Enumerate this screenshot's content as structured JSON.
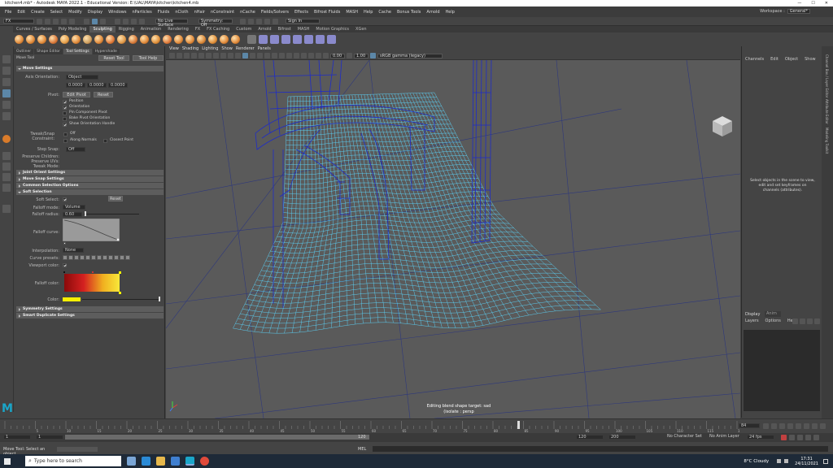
{
  "window": {
    "title": "kitchen4.mb* - Autodesk MAYA 2022.1 - Educational Version: E:\\UAL\\MAYA\\kitchen\\kitchen4.mb",
    "controls": [
      "—",
      "☐",
      "✕"
    ]
  },
  "menu": {
    "items": [
      "File",
      "Edit",
      "Create",
      "Select",
      "Modify",
      "Display",
      "Windows",
      "nParticles",
      "Fluids",
      "nCloth",
      "nHair",
      "nConstraint",
      "nCache",
      "Fields/Solvers",
      "Effects",
      "Bifrost Fluids",
      "MASH",
      "Help",
      "Cache",
      "Bonus Tools",
      "Arnold",
      "Help"
    ],
    "workspace_label": "Workspace :",
    "workspace_value": "General*"
  },
  "statusline": {
    "mode": "FX",
    "live_surface": "No Live Surface",
    "symmetry": "Symmetry: Off",
    "signin": "Sign In"
  },
  "shelf": {
    "tabs": [
      "Curves / Surfaces",
      "Poly Modeling",
      "Sculpting",
      "Rigging",
      "Animation",
      "Rendering",
      "FX",
      "FX Caching",
      "Custom",
      "Arnold",
      "Bifrost",
      "MASH",
      "Motion Graphics",
      "XGen"
    ],
    "active_tab": 2
  },
  "toolsettings": {
    "tabs": [
      "Outliner",
      "Shape Editor",
      "Tool Settings",
      "Hypershade"
    ],
    "tool_name": "Move Tool",
    "reset": "Reset Tool",
    "help": "Tool Help",
    "move_settings": "Move Settings",
    "axis_orientation_label": "Axis Orientation:",
    "axis_orientation": "Object",
    "xyz": [
      "0.0000",
      "0.0000",
      "0.0000"
    ],
    "pivot_label": "Pivot:",
    "edit_pivot": "Edit Pivot",
    "reset_btn": "Reset",
    "checks": [
      "Position",
      "Orientation",
      "Pin Component Pivot",
      "Bake Pivot Orientation",
      "Show Orientation Handle"
    ],
    "checks_on": [
      true,
      true,
      false,
      false,
      true
    ],
    "tweak_label": "Tweak/Snap Constraint:",
    "tweak_value": "Off",
    "along_normals": "Along Normals",
    "closest_point": "Closest Point",
    "step_snap_label": "Step Snap:",
    "step_snap": "Off",
    "preserve": [
      "Preserve Children:",
      "Preserve UVs:",
      "Tweak Mode:"
    ],
    "sections": [
      "Joint Orient Settings",
      "Move Snap Settings",
      "Common Selection Options",
      "Soft Selection",
      "Symmetry Settings",
      "Smart Duplicate Settings"
    ],
    "soft": {
      "soft_select_label": "Soft Select:",
      "reset": "Reset",
      "falloff_mode_label": "Falloff mode:",
      "falloff_mode": "Volume",
      "falloff_radius_label": "Falloff radius:",
      "falloff_radius": "0.60",
      "falloff_curve_label": "Falloff curve:",
      "interpolation_label": "Interpolation:",
      "interpolation": "None",
      "curve_presets_label": "Curve presets:",
      "viewport_color_label": "Viewport color:",
      "falloff_color_label": "Falloff color:",
      "color_label": "Color:"
    }
  },
  "viewport": {
    "menus": [
      "View",
      "Shading",
      "Lighting",
      "Show",
      "Renderer",
      "Panels"
    ],
    "field1": "0.00",
    "field2": "1.00",
    "colorspace": "sRGB gamma (legacy)",
    "hud_line1": "Editing blend shape target: sad",
    "hud_line2": "(isolate : persp"
  },
  "channelbox": {
    "menus": [
      "Channels",
      "Edit",
      "Object",
      "Show"
    ],
    "message": "Select objects in the scene to view, edit and set keyframes on channels (attributes)."
  },
  "layers": {
    "tabs": [
      "Display",
      "Anim"
    ],
    "menus": [
      "Layers",
      "Options",
      "Help"
    ]
  },
  "rightstrip": [
    "Channel Box / Layer Editor",
    "Attribute Editor",
    "Modeling Toolkit"
  ],
  "timeline": {
    "start": "1",
    "current": "1",
    "end": "120",
    "range_end": "120",
    "max": "200",
    "ticks": [
      "5",
      "10",
      "15",
      "20",
      "25",
      "30",
      "35",
      "40",
      "45",
      "50",
      "55",
      "60",
      "65",
      "70",
      "75",
      "80",
      "85",
      "90",
      "95",
      "100",
      "105",
      "110",
      "115",
      "120"
    ],
    "frame_field": "84",
    "char_set": "No Character Set",
    "anim_layer": "No Anim Layer",
    "fps": "24 fps"
  },
  "cmd": {
    "lang": "MEL",
    "feedback": "Move Tool: Select an object"
  },
  "taskbar": {
    "search": "Type here to search",
    "weather": "8°C  Cloudy",
    "time": "17:31",
    "date": "24/11/2021"
  },
  "colors": {
    "accent": "#5c87a8",
    "mesh_dark": "#1e2cc8",
    "mesh_light": "#5ad8ff"
  }
}
